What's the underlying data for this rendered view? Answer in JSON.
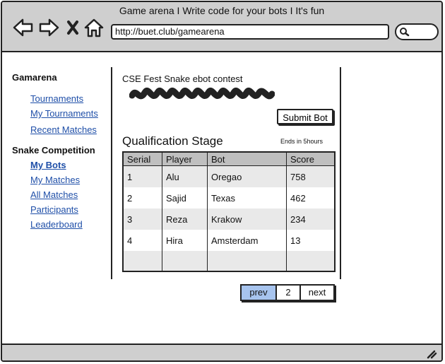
{
  "window": {
    "title": "Game arena I Write code for your bots I It's fun",
    "url": "http://buet.club/gamearena"
  },
  "icons": {
    "back": "back-arrow-icon",
    "forward": "forward-arrow-icon",
    "stop": "close-icon",
    "home": "home-icon",
    "search": "search-icon",
    "resize": "resize-grip-icon"
  },
  "sidebar": {
    "section1": "Gamarena",
    "links1": [
      "Tournaments",
      "My Tournaments",
      "Recent Matches"
    ],
    "section2": "Snake Competition",
    "links2": [
      "My Bots",
      "My Matches",
      "All Matches",
      "Participants",
      "Leaderboard"
    ]
  },
  "main": {
    "contest_title": "CSE Fest Snake ebot contest",
    "submit_label": "Submit Bot",
    "stage_title": "Qualification Stage",
    "ends_text": "Ends in 5hours",
    "table": {
      "headers": [
        "Serial",
        "Player",
        "Bot",
        "Score"
      ],
      "rows": [
        [
          "1",
          "Alu",
          "Oregao",
          "758"
        ],
        [
          "2",
          "Sajid",
          "Texas",
          "462"
        ],
        [
          "3",
          "Reza",
          "Krakow",
          "234"
        ],
        [
          "4",
          "Hira",
          "Amsterdam",
          "13"
        ]
      ]
    },
    "pager": {
      "prev": "prev",
      "page": "2",
      "next": "next"
    }
  },
  "colors": {
    "chrome": "#cfcfcf",
    "link": "#1f4fa8",
    "pager_active": "#a7c4ee",
    "table_header": "#bfbfbf"
  }
}
